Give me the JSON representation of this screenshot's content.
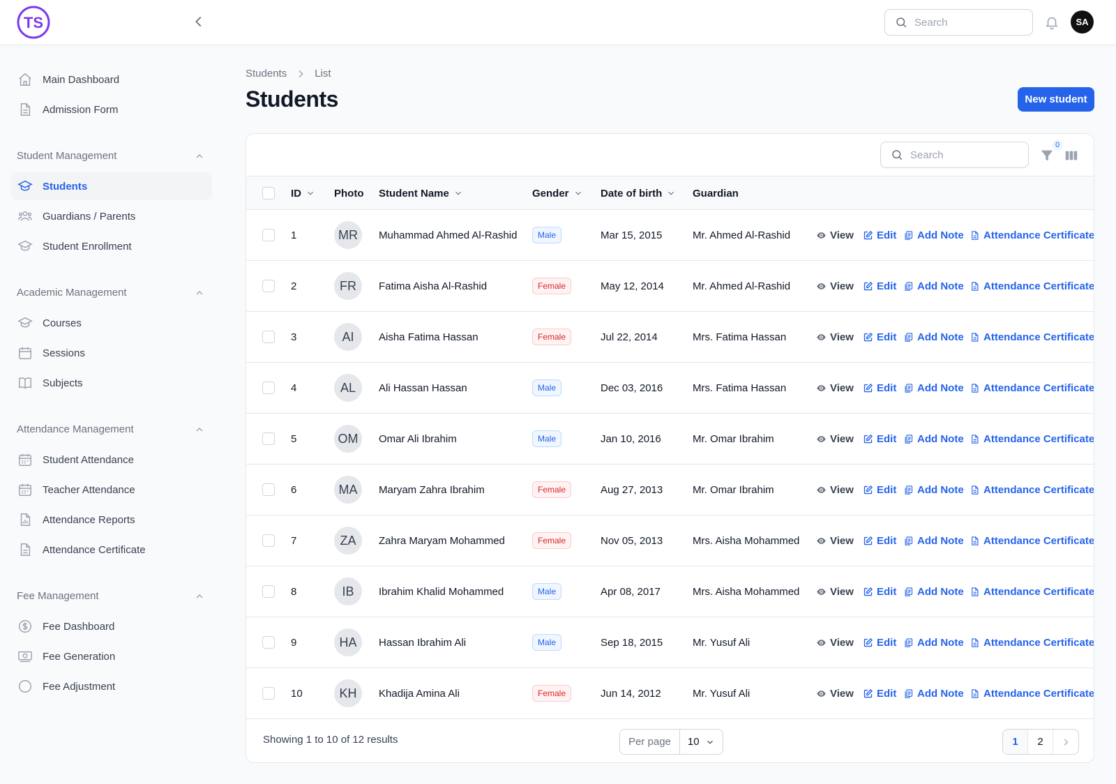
{
  "brand": {
    "logo_text": "TS",
    "accent": "#2563eb",
    "logo_color": "#7c3aed"
  },
  "topbar": {
    "search_placeholder": "Search",
    "user_initials": "SA"
  },
  "sidebar": {
    "top_items": [
      {
        "label": "Main Dashboard",
        "icon": "home-icon"
      },
      {
        "label": "Admission Form",
        "icon": "document-icon"
      }
    ],
    "groups": [
      {
        "title": "Student Management",
        "items": [
          {
            "label": "Students",
            "icon": "academic-cap-icon",
            "active": true
          },
          {
            "label": "Guardians / Parents",
            "icon": "users-icon"
          },
          {
            "label": "Student Enrollment",
            "icon": "academic-cap-icon"
          }
        ]
      },
      {
        "title": "Academic Management",
        "items": [
          {
            "label": "Courses",
            "icon": "academic-cap-icon"
          },
          {
            "label": "Sessions",
            "icon": "calendar-icon"
          },
          {
            "label": "Subjects",
            "icon": "book-icon"
          }
        ]
      },
      {
        "title": "Attendance Management",
        "items": [
          {
            "label": "Student Attendance",
            "icon": "calendar-days-icon"
          },
          {
            "label": "Teacher Attendance",
            "icon": "calendar-days-icon"
          },
          {
            "label": "Attendance Reports",
            "icon": "chart-document-icon"
          },
          {
            "label": "Attendance Certificate",
            "icon": "document-icon"
          }
        ]
      },
      {
        "title": "Fee Management",
        "items": [
          {
            "label": "Fee Dashboard",
            "icon": "currency-icon"
          },
          {
            "label": "Fee Generation",
            "icon": "banknote-icon"
          },
          {
            "label": "Fee Adjustment",
            "icon": "adjust-icon"
          }
        ]
      }
    ]
  },
  "breadcrumb": [
    "Students",
    "List"
  ],
  "page_title": "Students",
  "new_button": "New student",
  "table": {
    "search_placeholder": "Search",
    "filter_count": "0",
    "headers": {
      "id": "ID",
      "photo": "Photo",
      "name": "Student Name",
      "gender": "Gender",
      "dob": "Date of birth",
      "guardian": "Guardian"
    },
    "actions": {
      "view": "View",
      "edit": "Edit",
      "add_note": "Add Note",
      "certificate": "Attendance Certificate"
    },
    "rows": [
      {
        "id": "1",
        "initials": "MR",
        "name": "Muhammad Ahmed Al-Rashid",
        "gender": "Male",
        "dob": "Mar 15, 2015",
        "guardian": "Mr. Ahmed Al-Rashid"
      },
      {
        "id": "2",
        "initials": "FR",
        "name": "Fatima Aisha Al-Rashid",
        "gender": "Female",
        "dob": "May 12, 2014",
        "guardian": "Mr. Ahmed Al-Rashid"
      },
      {
        "id": "3",
        "initials": "AI",
        "name": "Aisha Fatima Hassan",
        "gender": "Female",
        "dob": "Jul 22, 2014",
        "guardian": "Mrs. Fatima Hassan"
      },
      {
        "id": "4",
        "initials": "AL",
        "name": "Ali Hassan Hassan",
        "gender": "Male",
        "dob": "Dec 03, 2016",
        "guardian": "Mrs. Fatima Hassan"
      },
      {
        "id": "5",
        "initials": "OM",
        "name": "Omar Ali Ibrahim",
        "gender": "Male",
        "dob": "Jan 10, 2016",
        "guardian": "Mr. Omar Ibrahim"
      },
      {
        "id": "6",
        "initials": "MA",
        "name": "Maryam Zahra Ibrahim",
        "gender": "Female",
        "dob": "Aug 27, 2013",
        "guardian": "Mr. Omar Ibrahim"
      },
      {
        "id": "7",
        "initials": "ZA",
        "name": "Zahra Maryam Mohammed",
        "gender": "Female",
        "dob": "Nov 05, 2013",
        "guardian": "Mrs. Aisha Mohammed"
      },
      {
        "id": "8",
        "initials": "IB",
        "name": "Ibrahim Khalid Mohammed",
        "gender": "Male",
        "dob": "Apr 08, 2017",
        "guardian": "Mrs. Aisha Mohammed"
      },
      {
        "id": "9",
        "initials": "HA",
        "name": "Hassan Ibrahim Ali",
        "gender": "Male",
        "dob": "Sep 18, 2015",
        "guardian": "Mr. Yusuf Ali"
      },
      {
        "id": "10",
        "initials": "KH",
        "name": "Khadija Amina Ali",
        "gender": "Female",
        "dob": "Jun 14, 2012",
        "guardian": "Mr. Yusuf Ali"
      }
    ]
  },
  "footer": {
    "showing": "Showing 1 to 10 of 12 results",
    "per_page_label": "Per page",
    "per_page_value": "10",
    "pages": [
      "1",
      "2"
    ],
    "current_page": "1"
  }
}
